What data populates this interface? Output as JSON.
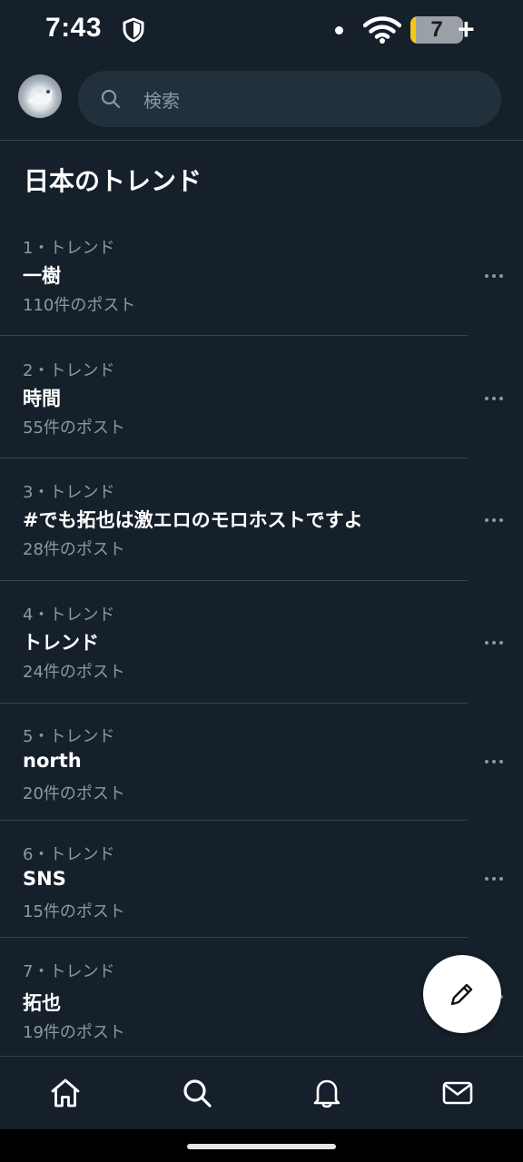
{
  "status_bar": {
    "time": "7:43",
    "battery_level": "7",
    "charging_symbol": "+",
    "icons": [
      "shield-icon",
      "notification-dot-icon",
      "wifi-icon",
      "battery-icon"
    ]
  },
  "header": {
    "search_placeholder": "検索"
  },
  "section": {
    "title": "日本のトレンド"
  },
  "trends": [
    {
      "meta": "1・トレンド",
      "name": "一樹",
      "count": "110件のポスト"
    },
    {
      "meta": "2・トレンド",
      "name": "時間",
      "count": "55件のポスト"
    },
    {
      "meta": "3・トレンド",
      "name": "#でも拓也は激エロのモロホストですよ",
      "count": "28件のポスト"
    },
    {
      "meta": "4・トレンド",
      "name": "トレンド",
      "count": "24件のポスト"
    },
    {
      "meta": "5・トレンド",
      "name": "north",
      "count": "20件のポスト"
    },
    {
      "meta": "6・トレンド",
      "name": "SNS",
      "count": "15件のポスト"
    },
    {
      "meta": "7・トレンド",
      "name": "拓也",
      "count": "19件のポスト"
    }
  ],
  "bottom_nav": {
    "items": [
      "home-icon",
      "search-icon",
      "bell-icon",
      "mail-icon"
    ]
  },
  "colors": {
    "background": "#15202b",
    "search_background": "#22303c",
    "secondary_text": "#8b98a5",
    "divider": "#38444d",
    "battery_fill": "#f5c518"
  }
}
